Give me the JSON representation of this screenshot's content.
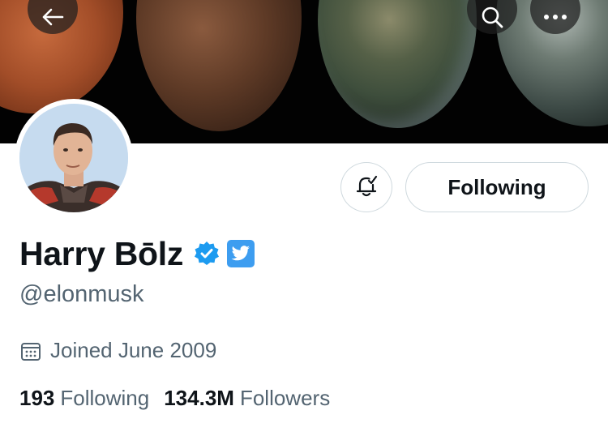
{
  "profile": {
    "display_name": "Harry Bōlz",
    "handle": "@elonmusk",
    "joined": "Joined June 2009",
    "following_count": "193",
    "following_label": "Following",
    "followers_count": "134.3M",
    "followers_label": "Followers"
  },
  "actions": {
    "following_button": "Following"
  },
  "icons": {
    "back": "arrow-left-icon",
    "search": "search-icon",
    "more": "more-dots-icon",
    "notify": "bell-check-icon",
    "verified": "verified-badge-icon",
    "twitter": "twitter-bird-icon",
    "calendar": "calendar-icon"
  },
  "colors": {
    "accent": "#1d9bf0",
    "text": "#0f1419",
    "muted": "#536471",
    "border": "#cfd9de"
  }
}
